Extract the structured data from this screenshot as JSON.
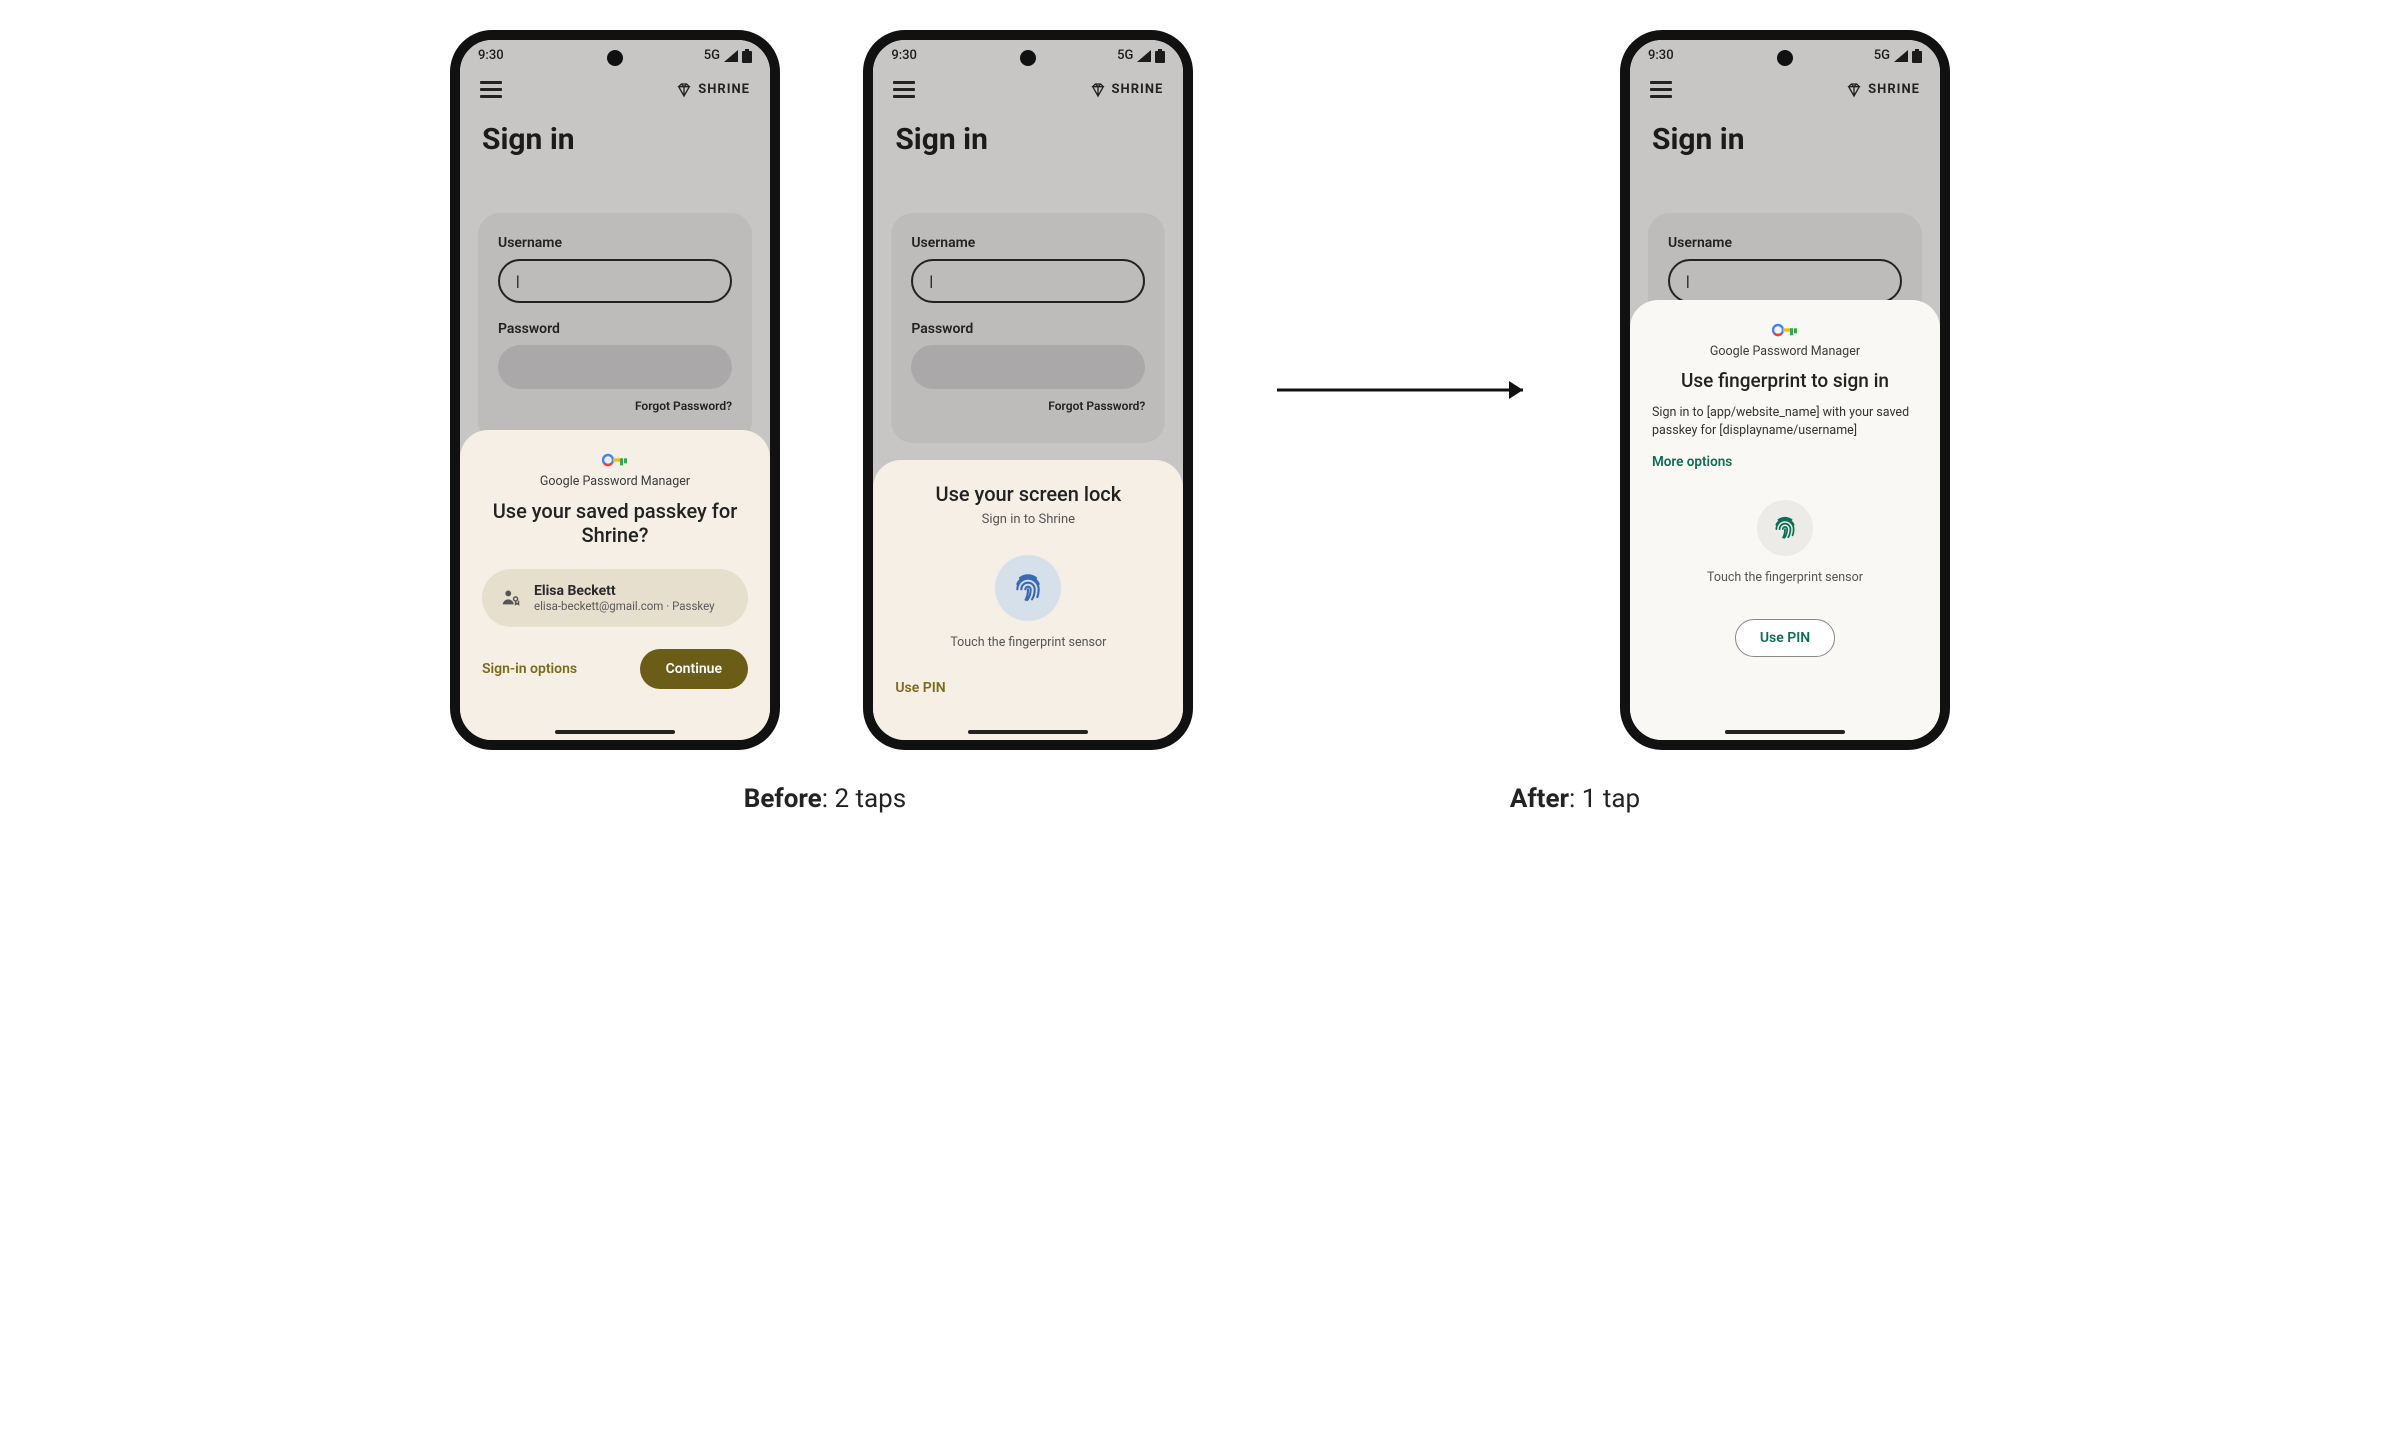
{
  "status": {
    "time": "9:30",
    "network": "5G"
  },
  "app": {
    "brand": "SHRINE",
    "pageTitle": "Sign in"
  },
  "form": {
    "usernameLabel": "Username",
    "usernameValue": "|",
    "passwordLabel": "Password",
    "forgot": "Forgot Password?"
  },
  "gpm": {
    "label": "Google Password Manager"
  },
  "sheet1": {
    "title": "Use your saved passkey for Shrine?",
    "accountName": "Elisa Beckett",
    "accountSub": "elisa-beckett@gmail.com · Passkey",
    "optionsLabel": "Sign-in options",
    "continueLabel": "Continue"
  },
  "sheet2": {
    "title": "Use your screen lock",
    "subtitle": "Sign in to Shrine",
    "fpCaption": "Touch the fingerprint sensor",
    "usePin": "Use PIN"
  },
  "sheet3": {
    "title": "Use fingerprint to sign in",
    "body": "Sign in to [app/website_name] with your saved passkey for [displayname/username]",
    "more": "More options",
    "fpCaption": "Touch the fingerprint sensor",
    "usePin": "Use PIN"
  },
  "captions": {
    "beforeBold": "Before",
    "beforeRest": ": 2 taps",
    "afterBold": "After",
    "afterRest": ": 1 tap"
  }
}
